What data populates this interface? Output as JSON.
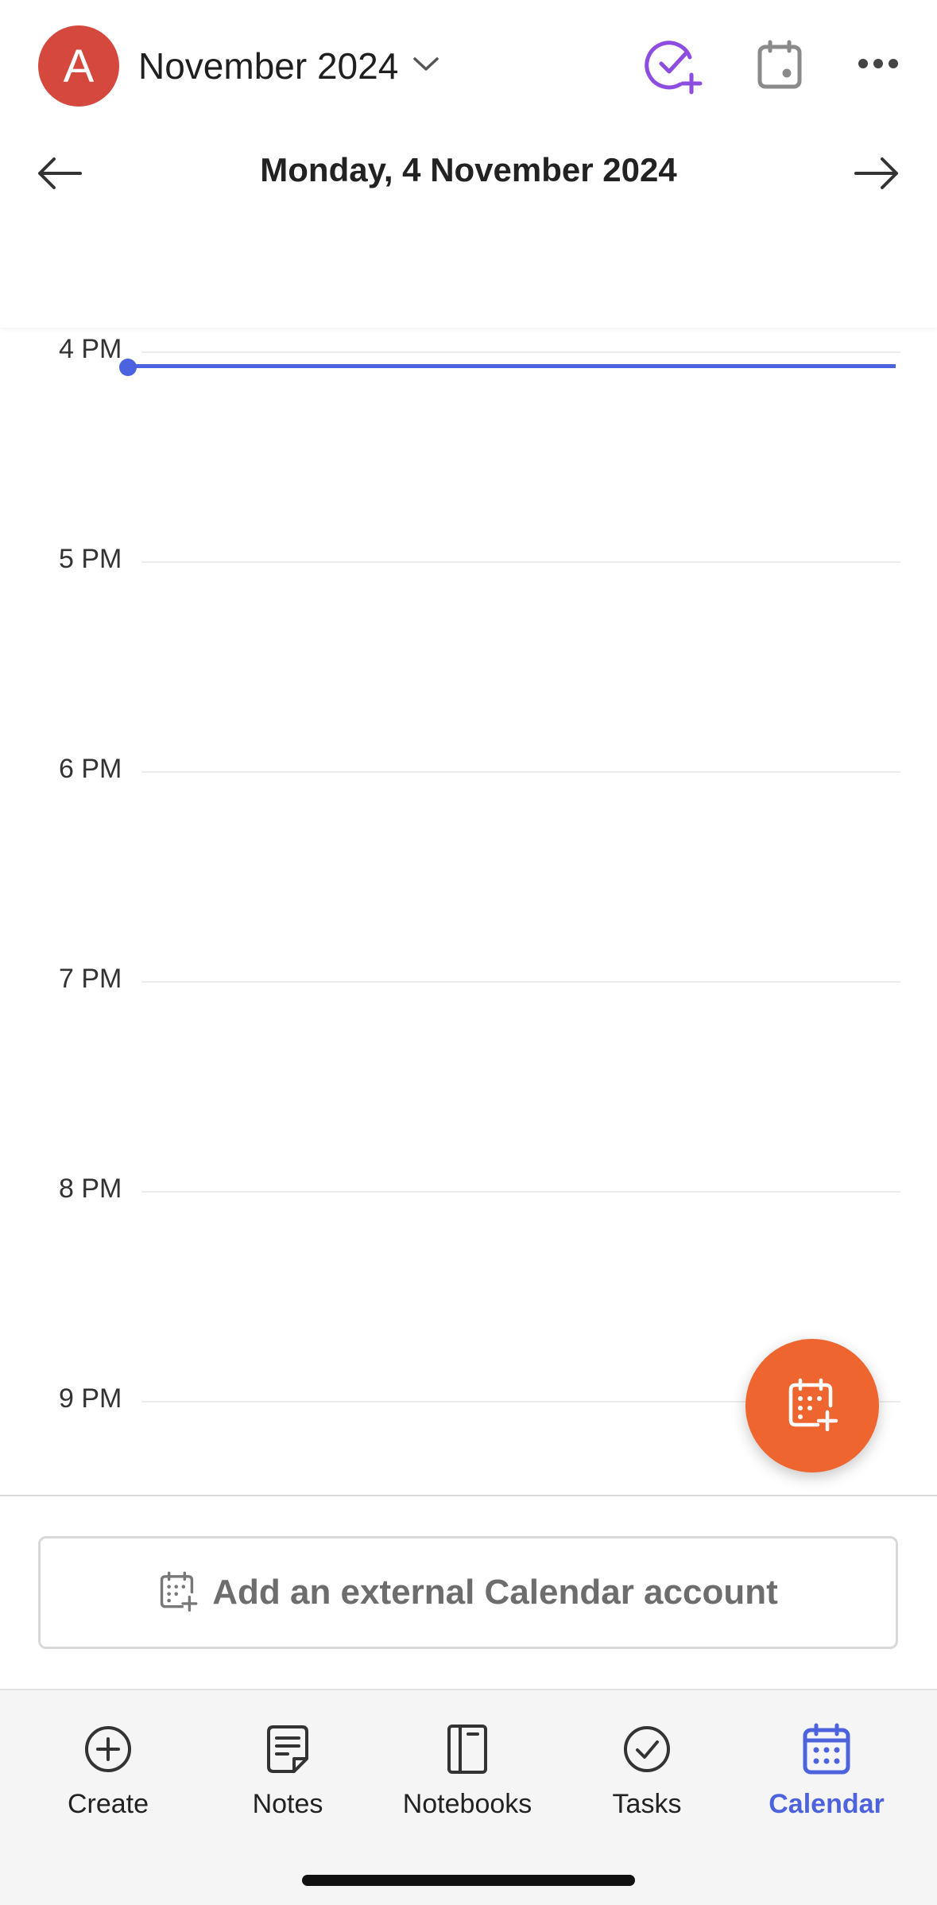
{
  "header": {
    "avatar_letter": "A",
    "month_label": "November 2024",
    "date_title": "Monday, 4 November 2024",
    "accent_color": "#8c4de0",
    "icons": [
      "chevron-down-icon",
      "task-add-icon",
      "calendar-today-icon",
      "more-icon",
      "arrow-left-icon",
      "arrow-right-icon"
    ]
  },
  "timeline": {
    "hours": [
      "4 PM",
      "5 PM",
      "6 PM",
      "7 PM",
      "8 PM",
      "9 PM"
    ],
    "now_indicator_color": "#4b63e0"
  },
  "fab": {
    "icon": "calendar-add-icon",
    "color": "#ef6530"
  },
  "external": {
    "label": "Add an external Calendar account",
    "icon": "calendar-add-icon"
  },
  "nav": {
    "items": [
      {
        "label": "Create",
        "icon": "plus-circle-icon",
        "active": false
      },
      {
        "label": "Notes",
        "icon": "note-icon",
        "active": false
      },
      {
        "label": "Notebooks",
        "icon": "notebook-icon",
        "active": false
      },
      {
        "label": "Tasks",
        "icon": "check-circle-icon",
        "active": false
      },
      {
        "label": "Calendar",
        "icon": "calendar-icon",
        "active": true
      }
    ],
    "active_color": "#4d63dd"
  }
}
